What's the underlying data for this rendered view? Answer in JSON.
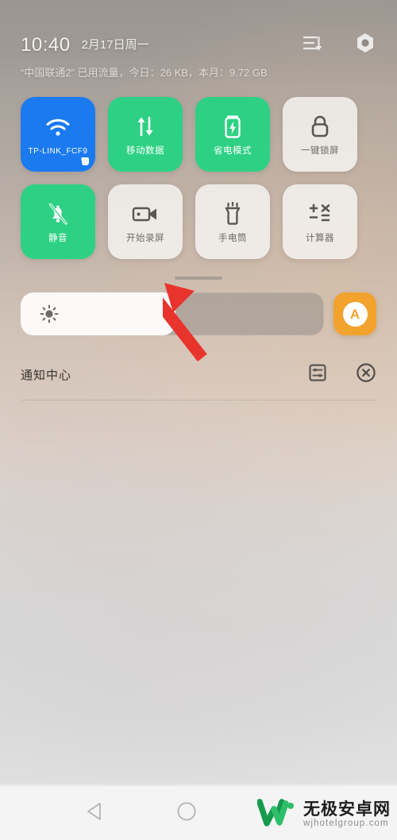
{
  "statusbar": {
    "time": "10:40",
    "date": "2月17日周一",
    "data_usage": "“中国联通2” 已用流量，今日：26 KB，本月：9.72 GB",
    "sort_icon": "sort-descending-icon",
    "settings_icon": "gear-icon"
  },
  "tiles": [
    {
      "label": "TP-LINK_FCF9",
      "icon": "wifi-icon",
      "state": "on-blue",
      "name": "tile-wifi"
    },
    {
      "label": "移动数据",
      "icon": "mobile-data-icon",
      "state": "on-green",
      "name": "tile-mobile-data"
    },
    {
      "label": "省电模式",
      "icon": "battery-saver-icon",
      "state": "on-green",
      "name": "tile-power-saving"
    },
    {
      "label": "一键锁屏",
      "icon": "lock-icon",
      "state": "off",
      "name": "tile-lock-screen"
    },
    {
      "label": "静音",
      "icon": "bell-muted-icon",
      "state": "on-green",
      "name": "tile-mute"
    },
    {
      "label": "开始录屏",
      "icon": "video-camera-icon",
      "state": "off",
      "name": "tile-screen-record"
    },
    {
      "label": "手电筒",
      "icon": "flashlight-icon",
      "state": "off",
      "name": "tile-flashlight"
    },
    {
      "label": "计算器",
      "icon": "calculator-icon",
      "state": "off",
      "name": "tile-calculator"
    }
  ],
  "brightness": {
    "icon": "sun-icon",
    "level_percent": 51,
    "auto_label": "A",
    "auto_color": "#f2a32e"
  },
  "notification_center": {
    "title": "通知中心",
    "settings_icon": "notification-settings-icon",
    "clear_icon": "clear-all-icon"
  },
  "navbar": {
    "back_icon": "back-triangle-icon",
    "home_icon": "home-circle-icon"
  },
  "watermark": {
    "logo": "w-logo-icon",
    "site_cn": "无极安卓网",
    "site_url": "wjhotelgroup.com"
  },
  "annotation": {
    "arrow_color": "#e8342c",
    "points_to": "tile-screen-record"
  },
  "colors": {
    "tile_on_blue": "#1b7af0",
    "tile_on_green": "#2ed183",
    "tile_off": "#f7f5f3",
    "accent_orange": "#f2a32e"
  }
}
